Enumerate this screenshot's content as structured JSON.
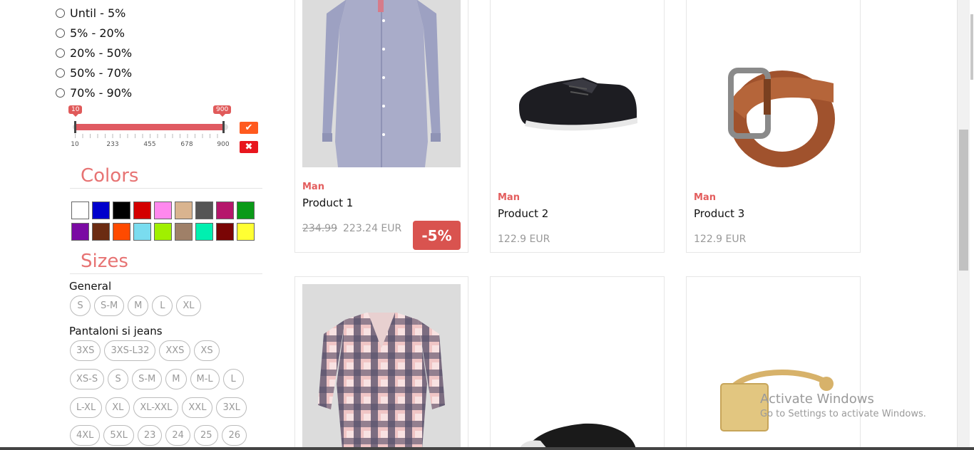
{
  "filters": {
    "discounts": [
      "Until - 5%",
      "5% - 20%",
      "20% - 50%",
      "50% - 70%",
      "70% - 90%"
    ],
    "price_slider": {
      "min_value": "10",
      "max_value": "900",
      "range_min": 10,
      "range_max": 900,
      "ticks": [
        "10",
        "233",
        "455",
        "678",
        "900"
      ],
      "apply_icon": "checkmark-icon",
      "clear_icon": "x-icon",
      "apply_color": "#ff5a1f",
      "clear_color": "#e8161e"
    },
    "colors_title": "Colors",
    "colors": [
      "#ffffff",
      "#0000cc",
      "#000000",
      "#d40000",
      "#ff88ee",
      "#d9b48f",
      "#555555",
      "#b5166b",
      "#0a9a18",
      "#7a0aa3",
      "#6b2b12",
      "#ff4a00",
      "#7adcef",
      "#a0f000",
      "#9f8068",
      "#00f0b0",
      "#7a0505",
      "#ffff33"
    ],
    "sizes_title": "Sizes",
    "size_groups": [
      {
        "label": "General",
        "sizes": [
          "S",
          "S-M",
          "M",
          "L",
          "XL"
        ]
      },
      {
        "label": "Pantaloni si jeans",
        "rows": [
          [
            "3XS",
            "3XS-L32",
            "XXS",
            "XS"
          ],
          [
            "XS-S",
            "S",
            "S-M",
            "M",
            "M-L",
            "L"
          ],
          [
            "L-XL",
            "XL",
            "XL-XXL",
            "XXL",
            "3XL"
          ],
          [
            "4XL",
            "5XL",
            "23",
            "24",
            "25",
            "26"
          ]
        ]
      }
    ]
  },
  "products": [
    {
      "brand": "Man",
      "name": "Product 1",
      "old_price": "234.99",
      "price": "223.24 EUR",
      "badge": "-5%",
      "image": "shirt"
    },
    {
      "brand": "Man",
      "name": "Product 2",
      "price": "122.9 EUR",
      "image": "sneaker"
    },
    {
      "brand": "Man",
      "name": "Product 3",
      "price": "122.9 EUR",
      "image": "belt"
    },
    {
      "image": "plaid-shirt"
    },
    {
      "image": "slipper"
    },
    {
      "image": "ring"
    }
  ],
  "watermark": {
    "line1": "Activate Windows",
    "line2": "Go to Settings to activate Windows."
  },
  "accent_color": "#e35d5d"
}
